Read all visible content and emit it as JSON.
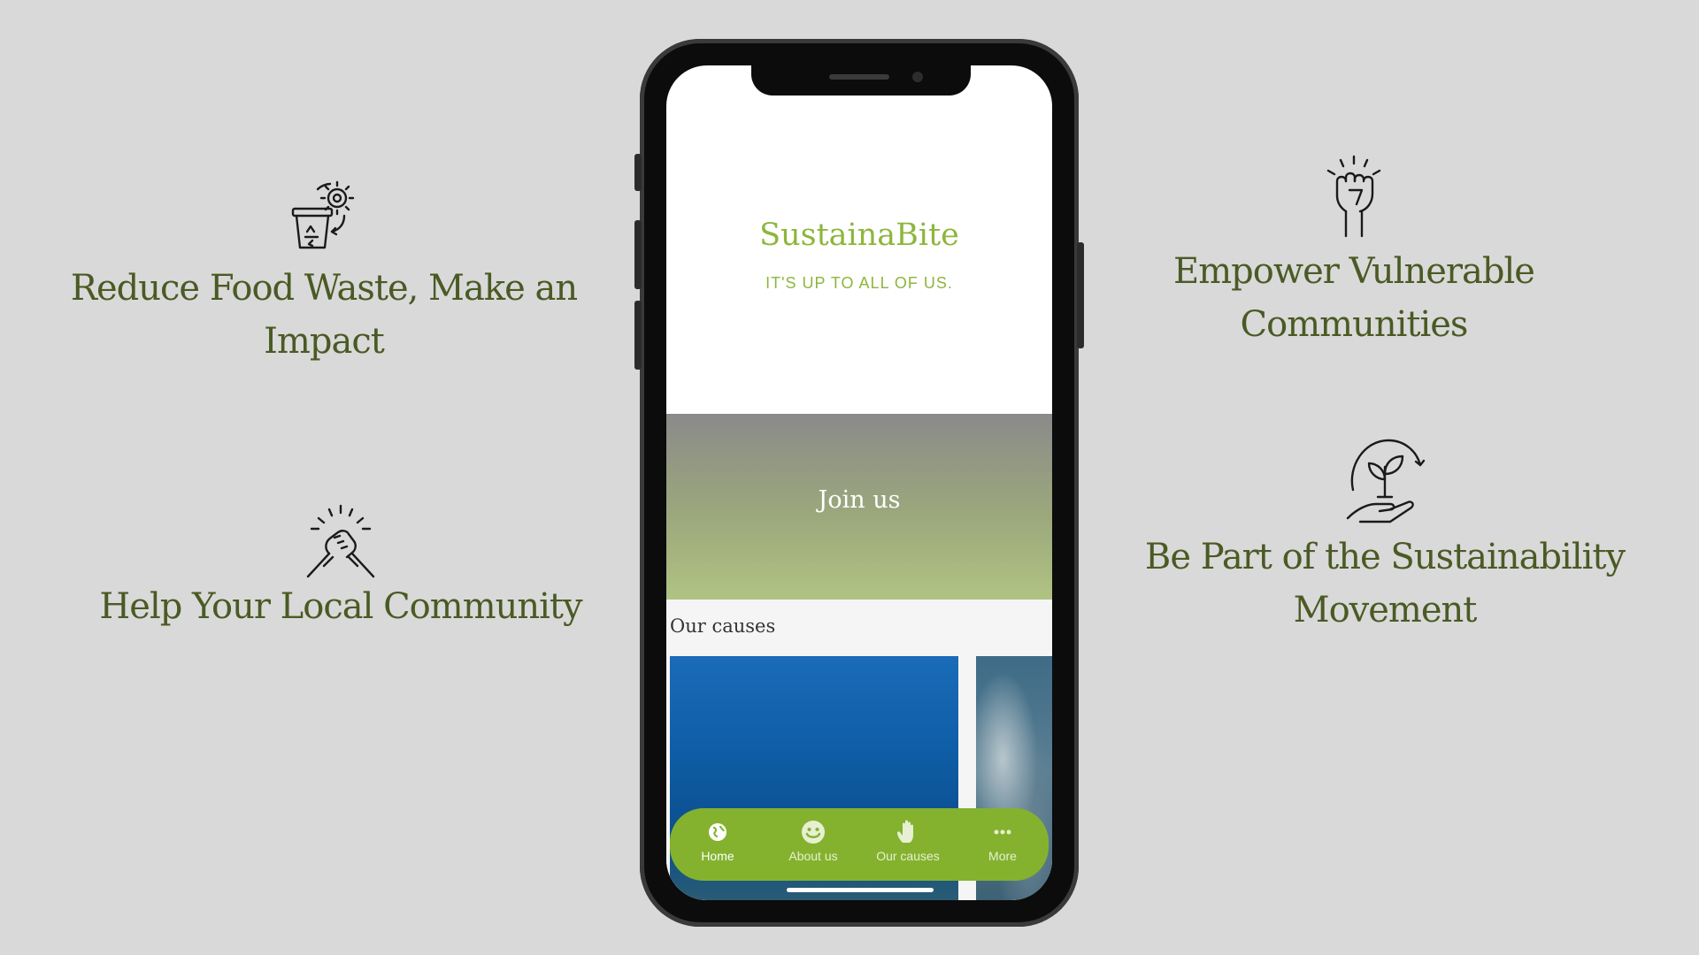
{
  "features": {
    "reduce_waste": {
      "text": "Reduce Food Waste, Make an Impact",
      "icon": "recycle-bin-gear-icon"
    },
    "local_community": {
      "text": "Help Your Local Community",
      "icon": "handshake-icon"
    },
    "empower": {
      "text": "Empower Vulnerable Communities",
      "icon": "raised-fist-icon"
    },
    "movement": {
      "text": "Be Part of the Sustainability Movement",
      "icon": "plant-hand-icon"
    }
  },
  "app": {
    "brand": "SustainaBite",
    "tagline": "IT'S UP TO ALL OF US.",
    "join_label": "Join us",
    "causes_title": "Our causes",
    "nav": [
      {
        "label": "Home",
        "icon": "globe-icon"
      },
      {
        "label": "About us",
        "icon": "smiley-icon"
      },
      {
        "label": "Our causes",
        "icon": "hand-icon"
      },
      {
        "label": "More",
        "icon": "more-dots-icon"
      }
    ]
  },
  "colors": {
    "background": "#d9d9d9",
    "feature_text": "#4a5a24",
    "brand_green": "#8db63c",
    "nav_green": "#84b22e"
  }
}
